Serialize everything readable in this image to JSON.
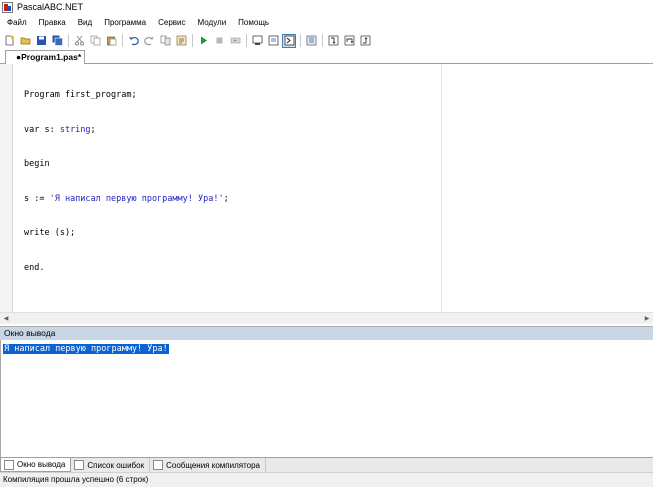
{
  "window": {
    "title": "PascalABC.NET"
  },
  "menu": [
    "Файл",
    "Правка",
    "Вид",
    "Программа",
    "Сервис",
    "Модули",
    "Помощь"
  ],
  "toolbar": {
    "buttons": [
      "new-file-icon",
      "open-folder-icon",
      "save-icon",
      "save-all-icon",
      "cut-icon",
      "copy-icon",
      "paste-icon",
      "undo-icon",
      "redo-icon",
      "find-icon",
      "run-icon",
      "stop-icon",
      "step-icon",
      "console-icon",
      "output-window-icon",
      "format-icon",
      "debug-step-into-icon",
      "debug-step-over-icon",
      "debug-step-out-icon"
    ]
  },
  "editor": {
    "tab_label": "●Program1.pas*",
    "code_lines": [
      [
        "Program first_program;",
        "",
        ""
      ],
      [
        "var s: ",
        "string",
        ";"
      ],
      [
        "begin",
        "",
        ""
      ],
      [
        "s := ",
        "'Я написал первую программу! Ура!'",
        ";"
      ],
      [
        "write (s);",
        "",
        ""
      ],
      [
        "end.",
        "",
        ""
      ]
    ]
  },
  "output": {
    "header": "Окно вывода",
    "text": "Я написал первую программу! Ура!"
  },
  "bottom_tabs": [
    {
      "label": "Окно вывода",
      "active": true
    },
    {
      "label": "Список ошибок",
      "active": false
    },
    {
      "label": "Сообщения компилятора",
      "active": false
    }
  ],
  "status": {
    "text": "Компиляция прошла успешно (6 строк)"
  },
  "colors": {
    "output_header_bg": "#c9d6e6",
    "selection": "#0a63d2",
    "string_literal": "#1f1fc0"
  }
}
